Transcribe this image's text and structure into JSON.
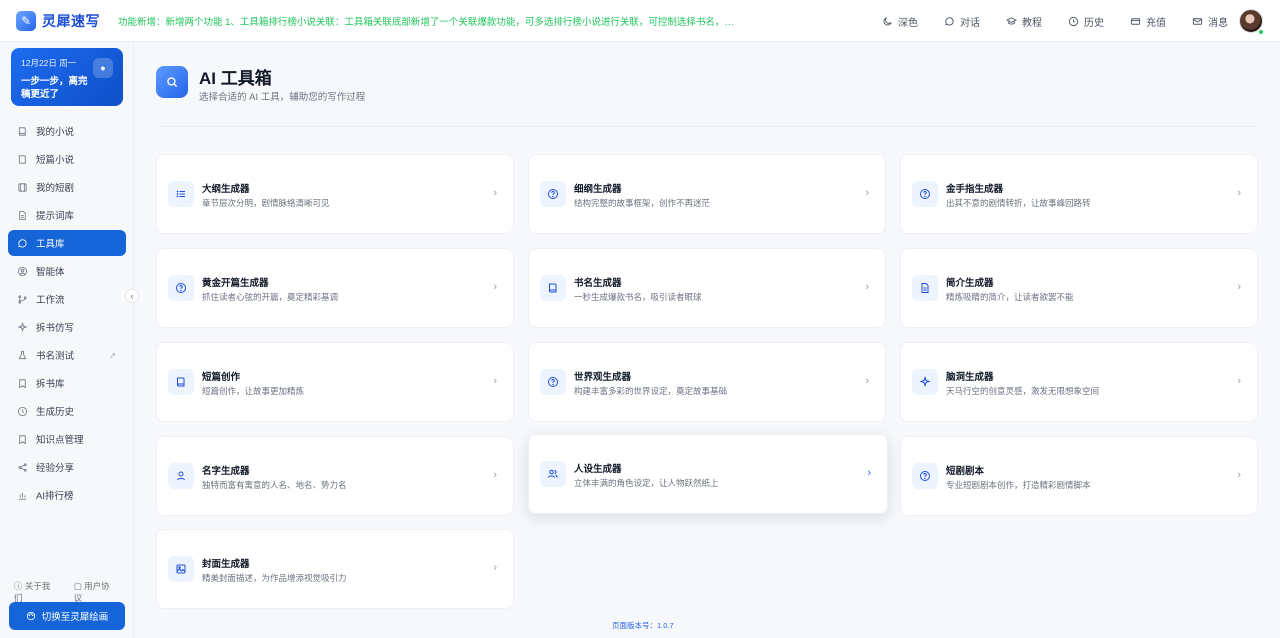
{
  "header": {
    "brand": "灵犀速写",
    "notice": "功能新增：新增两个功能 1、工具箱排行榜小说关联：工具箱关联底部新增了一个关联爆款功能，可多选排行榜小说进行关联，可控制选择书名，书...",
    "actions": [
      {
        "label": "深色",
        "icon": "moon-icon"
      },
      {
        "label": "对话",
        "icon": "chat-icon"
      },
      {
        "label": "教程",
        "icon": "graduation-cap-icon"
      },
      {
        "label": "历史",
        "icon": "clock-icon"
      },
      {
        "label": "充值",
        "icon": "card-icon"
      },
      {
        "label": "消息",
        "icon": "mail-icon"
      }
    ]
  },
  "sidebar": {
    "date": "12月22日 周一",
    "motto": "一步一步，离完稿更近了",
    "items": [
      {
        "label": "我的小说",
        "icon": "book-icon"
      },
      {
        "label": "短篇小说",
        "icon": "book-open-icon"
      },
      {
        "label": "我的短剧",
        "icon": "film-icon"
      },
      {
        "label": "提示词库",
        "icon": "document-icon"
      },
      {
        "label": "工具库",
        "icon": "chat-bubble-icon",
        "active": true
      },
      {
        "label": "智能体",
        "icon": "bot-icon"
      },
      {
        "label": "工作流",
        "icon": "branch-icon"
      },
      {
        "label": "拆书仿写",
        "icon": "sparkle-icon"
      },
      {
        "label": "书名测试",
        "icon": "flask-icon",
        "external": true
      },
      {
        "label": "拆书库",
        "icon": "bookmark-icon"
      },
      {
        "label": "生成历史",
        "icon": "history-icon"
      },
      {
        "label": "知识点管理",
        "icon": "bookmark-icon"
      },
      {
        "label": "经验分享",
        "icon": "share-icon"
      },
      {
        "label": "AI排行榜",
        "icon": "bar-chart-icon"
      }
    ],
    "footer_links": [
      "关于我们",
      "用户协议"
    ],
    "switch_label": "切换至灵犀绘画"
  },
  "main": {
    "title": "AI 工具箱",
    "subtitle": "选择合适的 AI 工具，辅助您的写作过程",
    "tools": [
      {
        "title": "大纲生成器",
        "desc": "章节层次分明，剧情脉络清晰可见",
        "icon": "list-icon"
      },
      {
        "title": "细纲生成器",
        "desc": "结构完整的故事框架，创作不再迷茫",
        "icon": "help-circle-icon"
      },
      {
        "title": "金手指生成器",
        "desc": "出其不意的剧情转折，让故事峰回路转",
        "icon": "help-circle-icon"
      },
      {
        "title": "黄金开篇生成器",
        "desc": "抓住读者心弦的开篇，奠定精彩基调",
        "icon": "help-circle-icon"
      },
      {
        "title": "书名生成器",
        "desc": "一秒生成爆款书名，吸引读者眼球",
        "icon": "book-icon"
      },
      {
        "title": "简介生成器",
        "desc": "精炼吸睛的简介，让读者欲罢不能",
        "icon": "document-icon"
      },
      {
        "title": "短篇创作",
        "desc": "短篇创作，让故事更加精炼",
        "icon": "book-icon"
      },
      {
        "title": "世界观生成器",
        "desc": "构建丰富多彩的世界设定，奠定故事基础",
        "icon": "help-circle-icon"
      },
      {
        "title": "脑洞生成器",
        "desc": "天马行空的创意灵感，激发无限想象空间",
        "icon": "sparkle-icon"
      },
      {
        "title": "名字生成器",
        "desc": "独特而富有寓意的人名、地名、势力名",
        "icon": "user-icon"
      },
      {
        "title": "人设生成器",
        "desc": "立体丰满的角色设定，让人物跃然纸上",
        "icon": "users-icon",
        "hover": true
      },
      {
        "title": "短剧剧本",
        "desc": "专业短剧剧本创作，打造精彩剧情脚本",
        "icon": "help-circle-icon"
      },
      {
        "title": "封面生成器",
        "desc": "精美封面描述，为作品增添视觉吸引力",
        "icon": "image-icon"
      }
    ],
    "version": "页面版本号：1.0.7"
  }
}
